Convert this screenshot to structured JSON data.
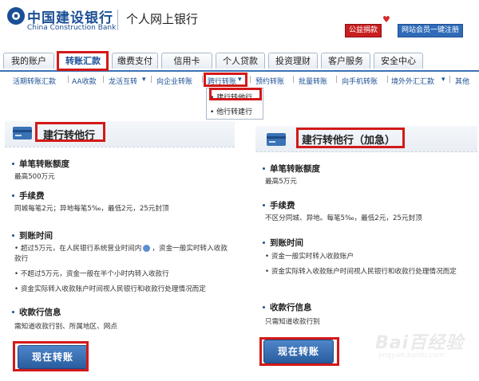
{
  "header": {
    "bank_name_cn": "中国建设银行",
    "bank_name_en": "China Construction Bank",
    "site_title": "个人网上银行",
    "donate_label": "公益捐款",
    "member_label": "网站会员一键注册"
  },
  "tabs": [
    "我的账户",
    "转账汇款",
    "缴费支付",
    "信用卡",
    "个人贷款",
    "投资理财",
    "客户服务",
    "安全中心"
  ],
  "active_tab": "转账汇款",
  "subnav": [
    "活期转账汇款",
    "AA收款",
    "龙活互转",
    "向企业转账",
    "跨行转账",
    "预约转账",
    "批量转账",
    "向手机转账",
    "境外外汇汇款",
    "其他"
  ],
  "dropdown": [
    "建行转他行",
    "他行转建行"
  ],
  "left_panel": {
    "title": "建行转他行",
    "sections": [
      {
        "heading": "单笔转账额度",
        "lines": [
          "最高500万元"
        ]
      },
      {
        "heading": "手续费",
        "lines": [
          "同城每笔2元；异地每笔5‰，最低2元，25元封顶"
        ]
      },
      {
        "heading": "到账时间",
        "lines": [
          "超过5万元，在人民银行系统营业时间内",
          "，资金一般实时转入收款",
          "款行",
          "不超过5万元，资金一般在半个小时内转入收款行",
          "资金实际转入收款账户时间视人民银行和收款行处理情况而定"
        ]
      },
      {
        "heading": "收款行信息",
        "lines": [
          "需知道收款行别、所属地区、网点"
        ]
      }
    ],
    "button": "现在转账"
  },
  "right_panel": {
    "title": "建行转他行（加急）",
    "sections": [
      {
        "heading": "单笔转账额度",
        "lines": [
          "最高5万元"
        ]
      },
      {
        "heading": "手续费",
        "lines": [
          "不区分同城、异地。每笔5‰，最低2元，25元封顶"
        ]
      },
      {
        "heading": "到账时间",
        "lines": [
          "资金一般实时转入收款账户",
          "资金实际转入收款账户时间视人民银行和收款行处理情况而定"
        ]
      },
      {
        "heading": "收款行信息",
        "lines": [
          "只需知道收款行别"
        ]
      }
    ],
    "button": "现在转账"
  },
  "watermark": {
    "brand": "Bai百经验",
    "url": "jingyan.baidu.com"
  },
  "colors": {
    "brand_blue": "#1b4f95",
    "highlight_red": "#d21919",
    "button_blue": "#2f6bb8"
  }
}
